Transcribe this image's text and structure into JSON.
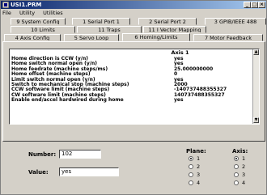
{
  "window": {
    "title": "USI1.PRM"
  },
  "menu": [
    "File",
    "Utility",
    "Utilities"
  ],
  "tabs_row1": [
    {
      "label": "9 System Config"
    },
    {
      "label": "1 Serial Port 1"
    },
    {
      "label": "2 Serial Port 2"
    },
    {
      "label": "3 GPIB/IEEE 488"
    }
  ],
  "tabs_row2": [
    {
      "label": "10 Limits"
    },
    {
      "label": "11 Traps"
    },
    {
      "label": "11 I Vector Mapping"
    }
  ],
  "tabs_row3": [
    {
      "label": "4 Axis Config"
    },
    {
      "label": "5 Servo Loop"
    },
    {
      "label": "6 Homing/Limits",
      "active": true
    },
    {
      "label": "7 Motor Feedback"
    }
  ],
  "list": {
    "header": "Axis 1",
    "rows": [
      {
        "k": "Home direction is CCW (y/n)",
        "v": "yes"
      },
      {
        "k": "Home switch normal open (y/n)",
        "v": "yes"
      },
      {
        "k": "Home feedrate (machine steps/ms)",
        "v": "25.000000000"
      },
      {
        "k": "Home offset (machine steps)",
        "v": "0"
      },
      {
        "k": "Limit switch normal open (y/n)",
        "v": "yes"
      },
      {
        "k": "Switch to mechanical stop (machine steps)",
        "v": "2000"
      },
      {
        "k": "CCW software limit (machine steps)",
        "v": "-140737488355327"
      },
      {
        "k": "CW software limit (machine steps)",
        "v": "140737488355327"
      },
      {
        "k": "Enable end/accel hardwired during home",
        "v": "yes"
      }
    ]
  },
  "number": {
    "label": "Number:",
    "value": "102"
  },
  "value": {
    "label": "Value:",
    "value": "yes"
  },
  "plane": {
    "label": "Plane:",
    "options": [
      "1",
      "2",
      "3",
      "4"
    ],
    "selected": 0
  },
  "axis": {
    "label": "Axis:",
    "options": [
      "1",
      "2",
      "3",
      "4"
    ],
    "selected": 0
  }
}
